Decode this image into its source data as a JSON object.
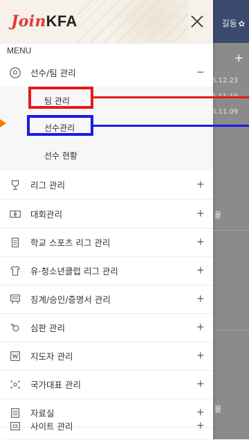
{
  "drawer": {
    "logo_join": "Join",
    "logo_kfa": "KFA",
    "close_icon": "close-x",
    "menu_heading": "MENU"
  },
  "menu": {
    "items": [
      {
        "label": "선수/팀 관리",
        "icon": "soccer-ball-icon",
        "toggle": "−"
      },
      {
        "label": "리그 관리",
        "icon": "trophy-icon",
        "toggle": "+"
      },
      {
        "label": "대회관리",
        "icon": "pitch-icon",
        "toggle": "+"
      },
      {
        "label": "학교 스포츠 리그 관리",
        "icon": "school-icon",
        "toggle": "+"
      },
      {
        "label": "유·청소년클럽 리그 관리",
        "icon": "jersey-icon",
        "toggle": "+"
      },
      {
        "label": "징계/승인/증명서 관리",
        "icon": "board-icon",
        "toggle": "+"
      },
      {
        "label": "심판 관리",
        "icon": "whistle-icon",
        "toggle": "+"
      },
      {
        "label": "지도자 관리",
        "icon": "coach-icon",
        "toggle": "+"
      },
      {
        "label": "국가대표 관리",
        "icon": "national-team-icon",
        "toggle": "+"
      },
      {
        "label": "자료실",
        "icon": "archive-icon",
        "toggle": "+"
      },
      {
        "label": "사이트 관리",
        "icon": "site-icon",
        "toggle": "+"
      }
    ],
    "sub_items": [
      "팀 관리",
      "선수관리",
      "선수 현황"
    ]
  },
  "background": {
    "user_text": "길동",
    "dates": [
      "6.12.23",
      "6.11.10",
      "6.11.09"
    ],
    "side_text_1": "을",
    "side_text_2": "을"
  },
  "colors": {
    "highlight_red": "#e41b17",
    "highlight_blue": "#1a1ae6",
    "logo_red": "#e53935"
  }
}
